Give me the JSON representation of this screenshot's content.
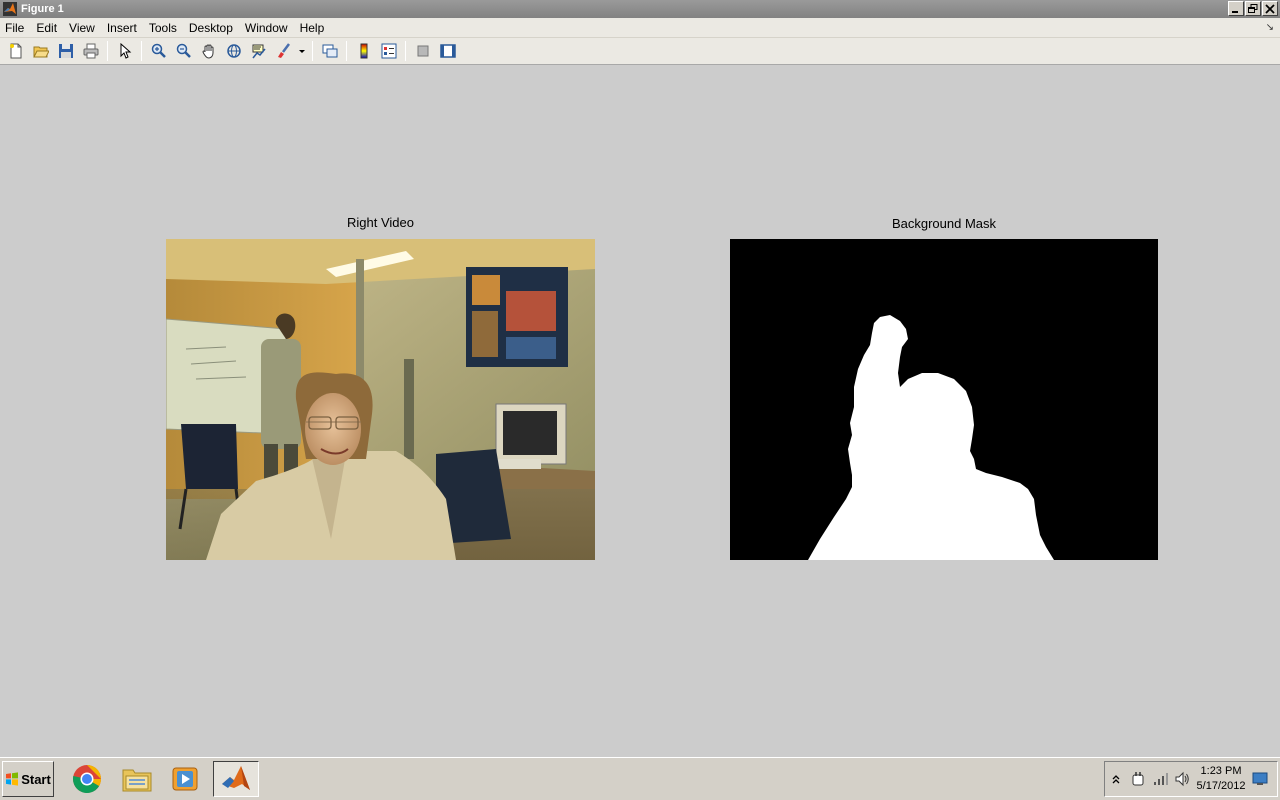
{
  "window": {
    "title": "Figure 1"
  },
  "menu": [
    "File",
    "Edit",
    "View",
    "Insert",
    "Tools",
    "Desktop",
    "Window",
    "Help"
  ],
  "toolbar": {
    "buttons": [
      "new-figure",
      "open-file",
      "save",
      "print",
      "edit-plot-arrow",
      "zoom-in",
      "zoom-out",
      "pan",
      "rotate-3d",
      "data-cursor",
      "brush",
      "brush-dropdown",
      "link-plot",
      "insert-colorbar",
      "insert-legend",
      "hide-plot-tools",
      "show-plot-tools"
    ]
  },
  "axes": [
    {
      "title": "Right Video",
      "content": "webcam-image"
    },
    {
      "title": "Background Mask",
      "content": "binary-mask-image"
    }
  ],
  "taskbar": {
    "start_label": "Start",
    "apps": [
      "chrome-icon",
      "folder-icon",
      "media-player-icon",
      "matlab-icon"
    ],
    "clock_time": "1:23 PM",
    "clock_date": "5/17/2012"
  },
  "colors": {
    "figure_bg": "#cccccc",
    "titlebar": "#8e8e8e",
    "mask_fg": "#ffffff",
    "mask_bg": "#000000"
  }
}
